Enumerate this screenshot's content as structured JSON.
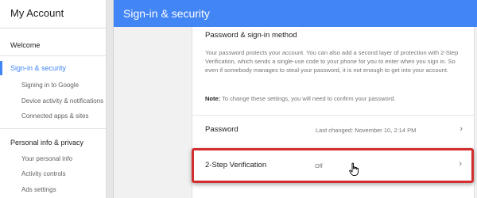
{
  "sidebar": {
    "title": "My Account",
    "items": [
      {
        "label": "Welcome"
      },
      {
        "label": "Sign-in & security"
      },
      {
        "label": "Signing in to Google"
      },
      {
        "label": "Device activity & notifications"
      },
      {
        "label": "Connected apps & sites"
      },
      {
        "label": "Personal info & privacy"
      },
      {
        "label": "Your personal info"
      },
      {
        "label": "Activity controls"
      },
      {
        "label": "Ads settings"
      }
    ]
  },
  "header": {
    "title": "Sign-in & security"
  },
  "card": {
    "title": "Password & sign-in method",
    "description": "Your password protects your account. You can also add a second layer of protection with 2-Step Verification, which sends a single-use code to your phone for you to enter when you sign in. So even if somebody manages to steal your password, it is not enough to get into your account.",
    "note_bold": "Note:",
    "note_text": " To change these settings, you will need to confirm your password.",
    "rows": [
      {
        "label": "Password",
        "value": "Last changed: November 10, 2:14 PM"
      },
      {
        "label": "2-Step Verification",
        "value": "Off"
      }
    ]
  },
  "colors": {
    "accent": "#4285f4",
    "highlight": "#d32f2f"
  }
}
